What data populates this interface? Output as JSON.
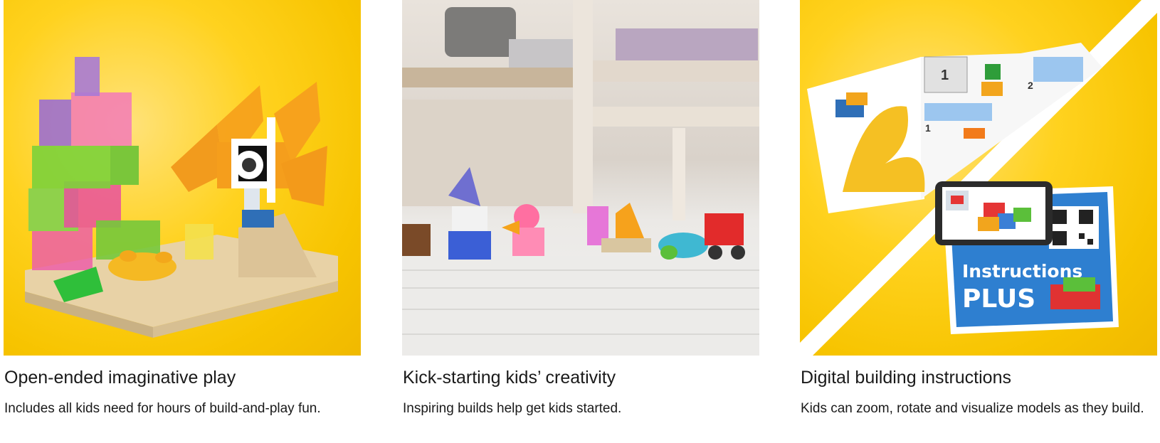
{
  "features": [
    {
      "title": "Open-ended imaginative play",
      "description": "Includes all kids need for hours of build-and-play fun.",
      "image_alt": "Transparent bricks built into a fish and coral scene"
    },
    {
      "title": "Kick-starting kids’ creativity",
      "description": "Inspiring builds help get kids started.",
      "image_alt": "Row of small brick models on a carpet"
    },
    {
      "title": "Digital building instructions",
      "description": "Kids can zoom, rotate and visualize models as they build.",
      "image_alt": "Instruction booklet and phone showing digital instructions",
      "badge": {
        "line1": "Instructions",
        "line2": "PLUS"
      },
      "booklet_steps": [
        "1",
        "1",
        "2"
      ]
    }
  ],
  "colors": {
    "yellow": "#ffd21f",
    "badge_blue": "#2e7fd0"
  }
}
